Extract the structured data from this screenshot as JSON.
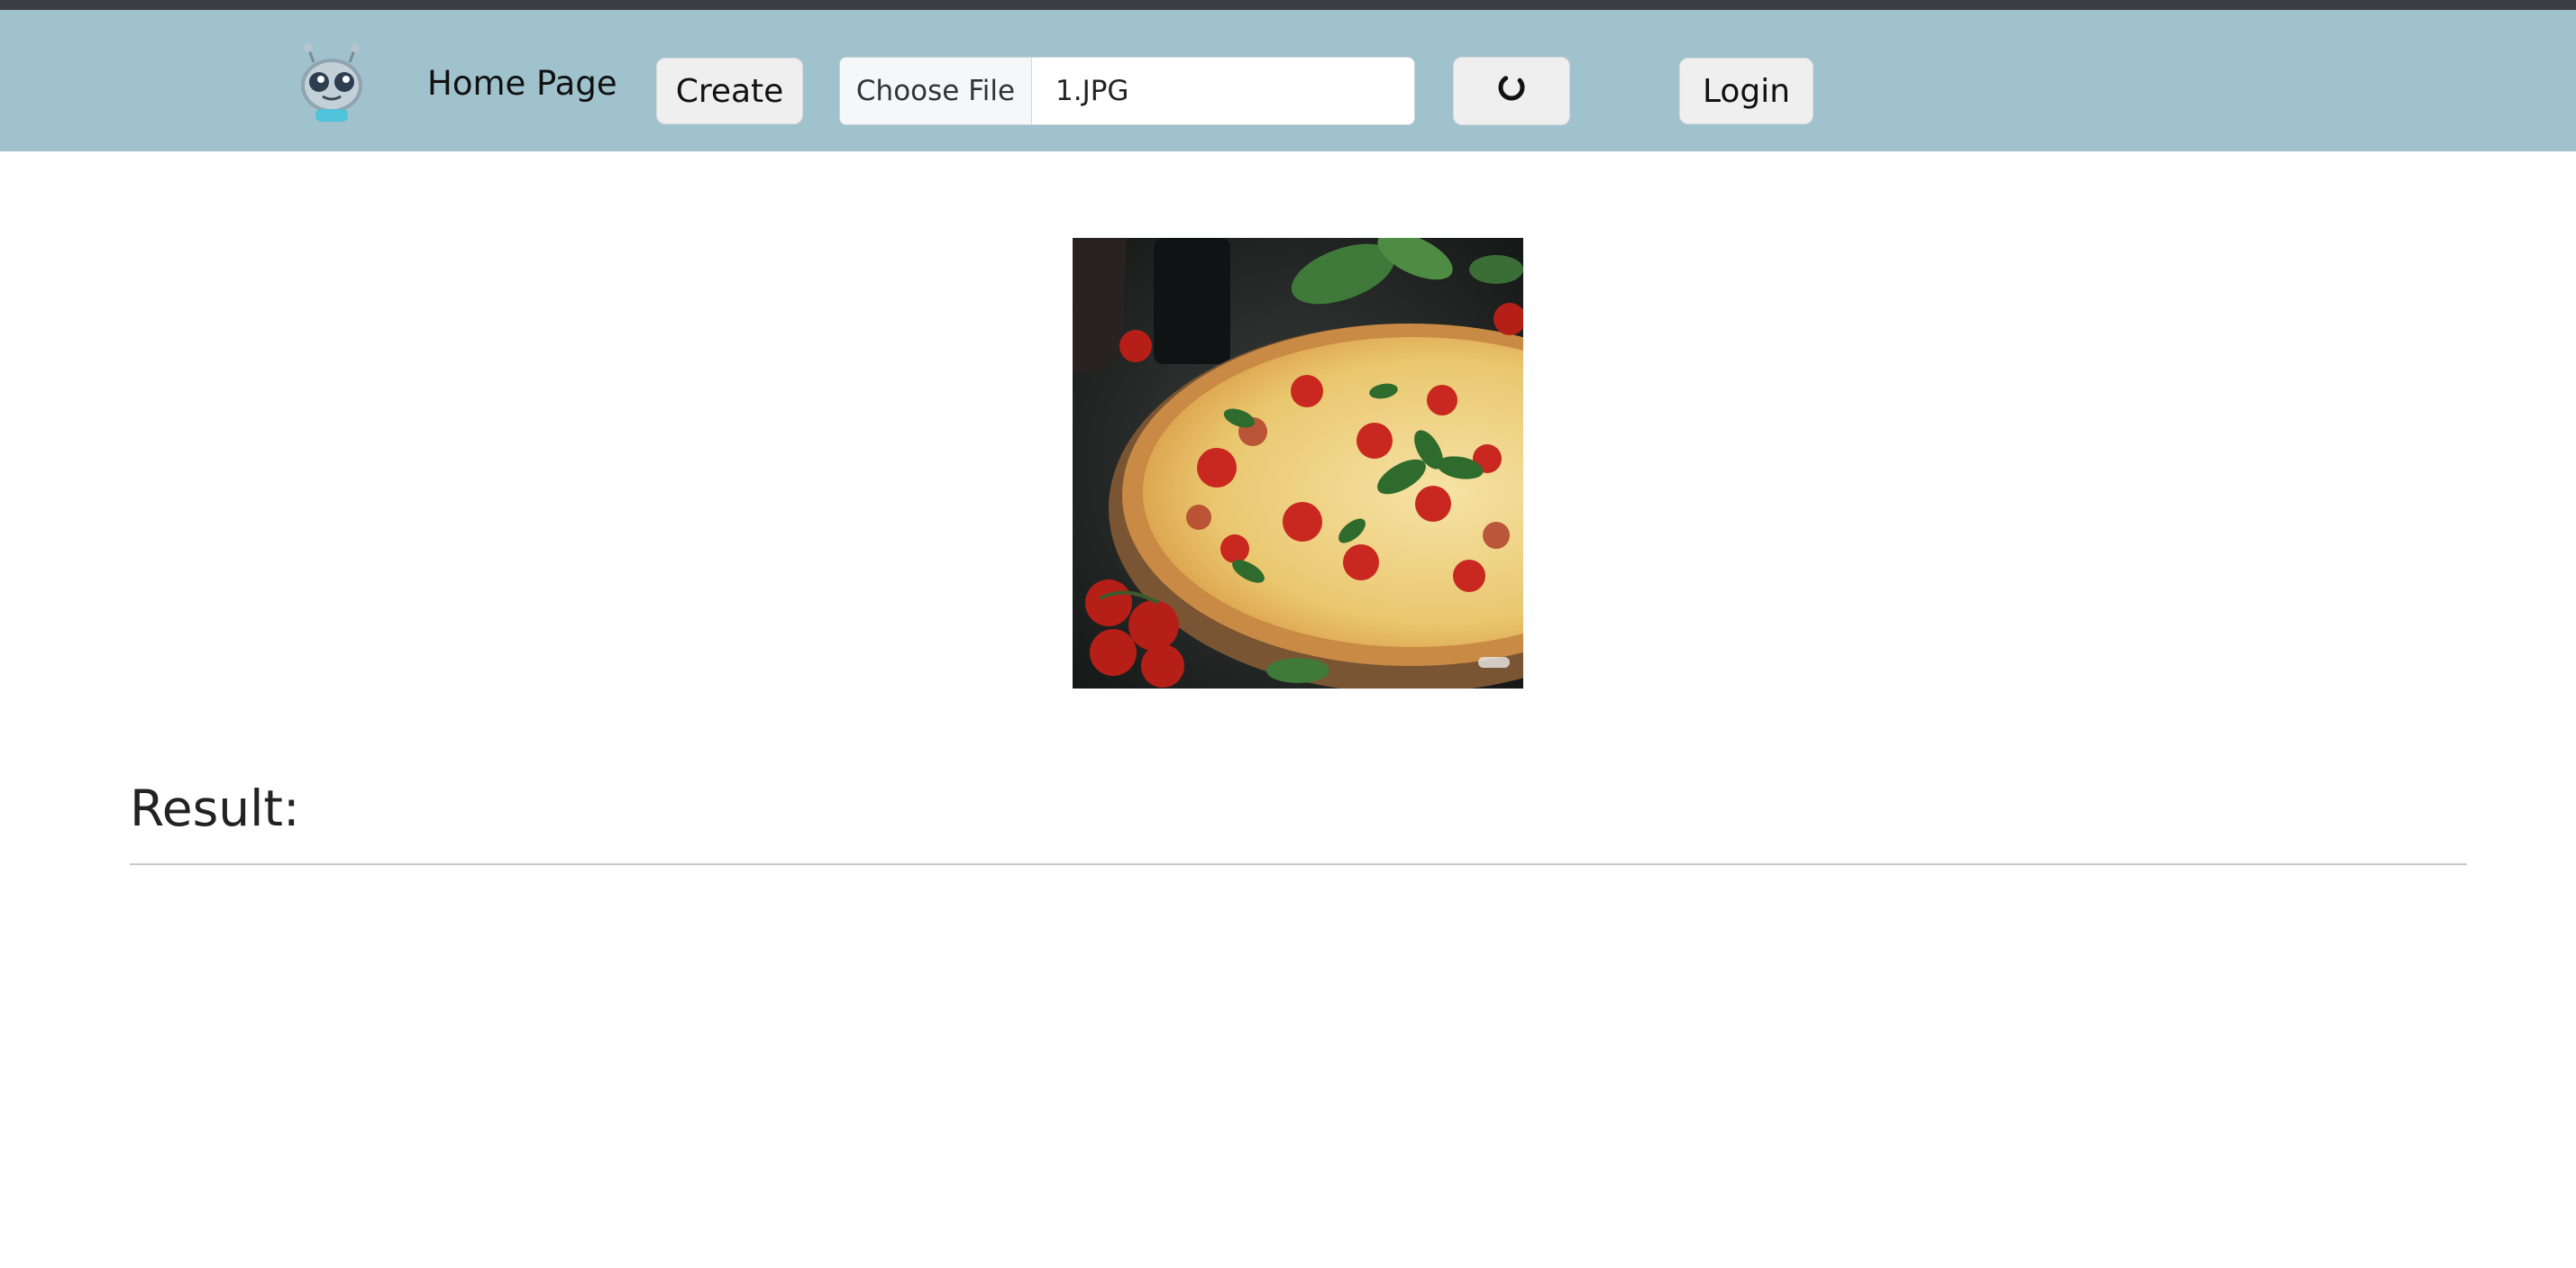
{
  "navbar": {
    "logo_icon": "robot-logo-icon",
    "home_label": "Home Page",
    "create_label": "Create",
    "file_input": {
      "choose_label": "Choose File",
      "file_name": "1.JPG"
    },
    "upload_icon": "loading-spinner-icon",
    "login_label": "Login",
    "colors": {
      "navbar_bg": "#a0c2cd",
      "top_strip": "#3b3f44",
      "button_bg": "#efefef"
    }
  },
  "main": {
    "preview_image": "pizza-photo",
    "result_heading": "Result:"
  }
}
